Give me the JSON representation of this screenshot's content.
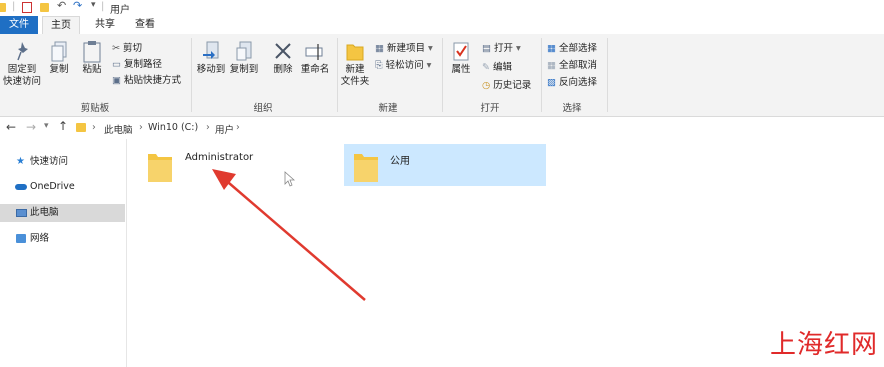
{
  "window": {
    "title": "用户"
  },
  "tabs": [
    {
      "label": "文件"
    },
    {
      "label": "主页"
    },
    {
      "label": "共享"
    },
    {
      "label": "查看"
    }
  ],
  "ribbon": {
    "clipboard": {
      "pin_label_line1": "固定到",
      "pin_label_line2": "快速访问",
      "copy_label": "复制",
      "paste_label": "粘贴",
      "cut_label": "剪切",
      "copy_path_label": "复制路径",
      "paste_shortcut_label": "粘贴快捷方式",
      "group_label": "剪贴板"
    },
    "organize": {
      "move_to_label": "移动到",
      "copy_to_label": "复制到",
      "delete_label": "删除",
      "rename_label": "重命名",
      "group_label": "组织"
    },
    "new": {
      "new_folder_line1": "新建",
      "new_folder_line2": "文件夹",
      "new_item_label": "新建项目",
      "easy_access_label": "轻松访问",
      "group_label": "新建"
    },
    "open": {
      "properties_label": "属性",
      "open_label": "打开",
      "edit_label": "编辑",
      "history_label": "历史记录",
      "group_label": "打开"
    },
    "select": {
      "select_all_label": "全部选择",
      "select_none_label": "全部取消",
      "invert_label": "反向选择",
      "group_label": "选择"
    }
  },
  "address": {
    "crumbs": [
      "此电脑",
      "Win10 (C:)",
      "用户"
    ],
    "separator": "›"
  },
  "nav_pane": {
    "items": [
      {
        "label": "快速访问"
      },
      {
        "label": "OneDrive"
      },
      {
        "label": "此电脑"
      },
      {
        "label": "网络"
      }
    ]
  },
  "content": {
    "folders": [
      {
        "name": "Administrator"
      },
      {
        "name": "公用"
      }
    ]
  },
  "watermark": {
    "text": "上海红网"
  },
  "colors": {
    "accent": "#1f6fc4",
    "folder": "#f4c542",
    "selection": "#cce8ff",
    "nav_selected": "#d9d9d9",
    "arrow": "#e03a2f",
    "watermark": "#e02a2a"
  }
}
